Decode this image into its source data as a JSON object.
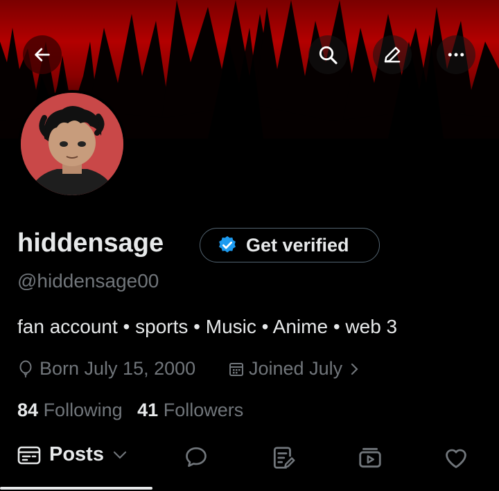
{
  "header": {
    "back_icon": "arrow-left-icon",
    "search_icon": "search-icon",
    "edit_icon": "pencil-icon",
    "more_icon": "more-dots-icon"
  },
  "profile": {
    "display_name": "hiddensage",
    "verify_label": "Get verified",
    "handle": "@hiddensage00",
    "bio": "fan account • sports • Music • Anime • web 3",
    "born": "Born July 15, 2000",
    "joined": "Joined July",
    "following_count": "84",
    "following_label": "Following",
    "followers_count": "41",
    "followers_label": "Followers"
  },
  "tabs": {
    "posts_label": "Posts",
    "icons": [
      "posts-icon",
      "chevron-down-icon",
      "replies-icon",
      "articles-icon",
      "media-icon",
      "likes-icon"
    ]
  },
  "colors": {
    "background": "#000000",
    "text_primary": "#e7e9ea",
    "text_secondary": "#71767b",
    "verified_blue": "#1d9bf0",
    "banner_red": "#b30000"
  }
}
